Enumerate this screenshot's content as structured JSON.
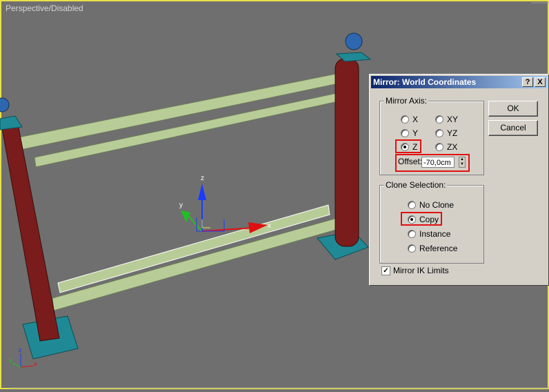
{
  "viewport": {
    "label": "Perspective/Disabled",
    "border_color": "#e7e24a",
    "background": "#6f6f6f"
  },
  "gizmo": {
    "z": "z",
    "y": "y",
    "x": "x"
  },
  "corner_axes": {
    "z": "z",
    "y": "y",
    "x": "x"
  },
  "colors": {
    "post": "#7a1c1c",
    "base": "#1f8a96",
    "ball": "#2d67b0",
    "rail": "#b8cc98",
    "highlight": "#e01010",
    "title_bar": "#0a246a"
  },
  "dialog": {
    "title": "Mirror: World Coordinates",
    "help_btn": "?",
    "close_btn": "X",
    "ok": "OK",
    "cancel": "Cancel",
    "mirror_axis": {
      "title": "Mirror Axis:",
      "options": [
        "X",
        "Y",
        "Z",
        "XY",
        "YZ",
        "ZX"
      ],
      "selected": "Z",
      "offset_label": "Offset:",
      "offset_value": "-70,0cm"
    },
    "clone_selection": {
      "title": "Clone Selection:",
      "options": [
        "No Clone",
        "Copy",
        "Instance",
        "Reference"
      ],
      "selected": "Copy"
    },
    "mirror_ik": {
      "label": "Mirror IK Limits",
      "checked": true
    }
  }
}
